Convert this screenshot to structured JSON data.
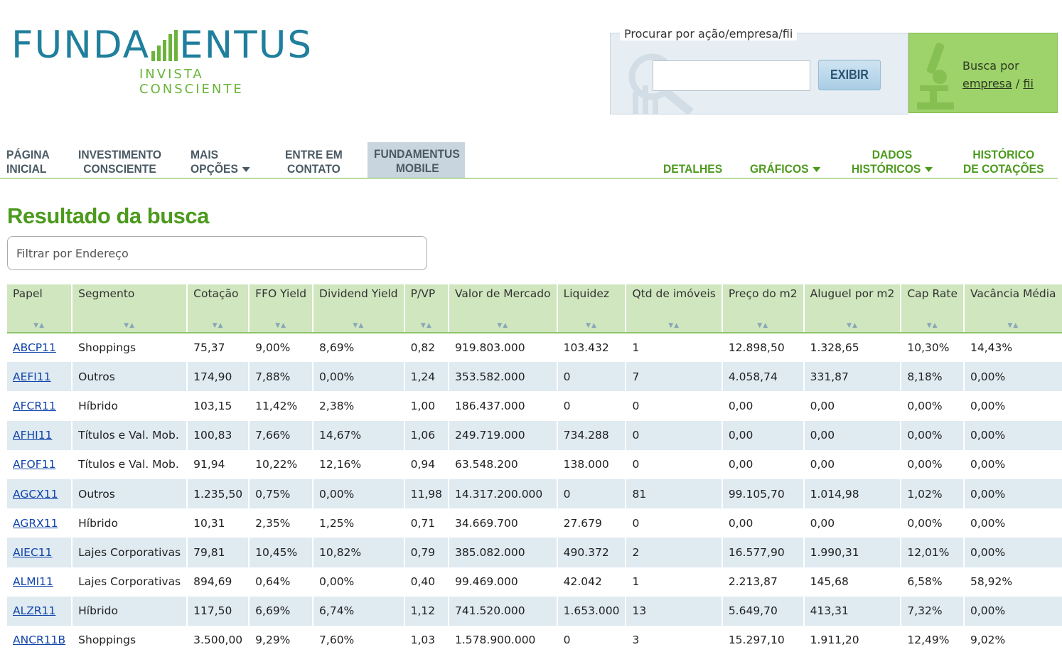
{
  "logo": {
    "main_left": "FUNDA",
    "main_right": "ENTUS",
    "tagline": "INVISTA CONSCIENTE"
  },
  "search": {
    "legend": "Procurar por ação/empresa/fii",
    "input_value": "",
    "button_label": "EXIBIR",
    "busca_prefix": "Busca por",
    "busca_link_empresa": "empresa",
    "busca_sep": " / ",
    "busca_link_fii": "fii"
  },
  "nav": {
    "pagina_inicial": [
      "PÁGINA",
      "INICIAL"
    ],
    "investimento": [
      "INVESTIMENTO",
      "CONSCIENTE"
    ],
    "mais_opcoes": [
      "MAIS",
      "OPÇÕES"
    ],
    "entre_em_contato": [
      "ENTRE EM",
      "CONTATO"
    ],
    "fundamentus_mobile": [
      "FUNDAMENTUS",
      "MOBILE"
    ],
    "detalhes": "DETALHES",
    "graficos": "GRÁFICOS",
    "dados_historicos": [
      "DADOS",
      "HISTÓRICOS"
    ],
    "historico_cotacoes": [
      "HISTÓRICO",
      "DE COTAÇÕES"
    ]
  },
  "page_title": "Resultado da busca",
  "filter_placeholder": "Filtrar por Endereço",
  "table": {
    "sort_glyph": "▼▲",
    "headers": [
      "Papel",
      "Segmento",
      "Cotação",
      "FFO Yield",
      "Dividend Yield",
      "P/VP",
      "Valor de Mercado",
      "Liquidez",
      "Qtd de imóveis",
      "Preço do m2",
      "Aluguel por m2",
      "Cap Rate",
      "Vacância Média"
    ],
    "rows": [
      [
        "ABCP11",
        "Shoppings",
        "75,37",
        "9,00%",
        "8,69%",
        "0,82",
        "919.803.000",
        "103.432",
        "1",
        "12.898,50",
        "1.328,65",
        "10,30%",
        "14,43%"
      ],
      [
        "AEFI11",
        "Outros",
        "174,90",
        "7,88%",
        "0,00%",
        "1,24",
        "353.582.000",
        "0",
        "7",
        "4.058,74",
        "331,87",
        "8,18%",
        "0,00%"
      ],
      [
        "AFCR11",
        "Híbrido",
        "103,15",
        "11,42%",
        "2,38%",
        "1,00",
        "186.437.000",
        "0",
        "0",
        "0,00",
        "0,00",
        "0,00%",
        "0,00%"
      ],
      [
        "AFHI11",
        "Títulos e Val. Mob.",
        "100,83",
        "7,66%",
        "14,67%",
        "1,06",
        "249.719.000",
        "734.288",
        "0",
        "0,00",
        "0,00",
        "0,00%",
        "0,00%"
      ],
      [
        "AFOF11",
        "Títulos e Val. Mob.",
        "91,94",
        "10,22%",
        "12,16%",
        "0,94",
        "63.548.200",
        "138.000",
        "0",
        "0,00",
        "0,00",
        "0,00%",
        "0,00%"
      ],
      [
        "AGCX11",
        "Outros",
        "1.235,50",
        "0,75%",
        "0,00%",
        "11,98",
        "14.317.200.000",
        "0",
        "81",
        "99.105,70",
        "1.014,98",
        "1,02%",
        "0,00%"
      ],
      [
        "AGRX11",
        "Híbrido",
        "10,31",
        "2,35%",
        "1,25%",
        "0,71",
        "34.669.700",
        "27.679",
        "0",
        "0,00",
        "0,00",
        "0,00%",
        "0,00%"
      ],
      [
        "AIEC11",
        "Lajes Corporativas",
        "79,81",
        "10,45%",
        "10,82%",
        "0,79",
        "385.082.000",
        "490.372",
        "2",
        "16.577,90",
        "1.990,31",
        "12,01%",
        "0,00%"
      ],
      [
        "ALMI11",
        "Lajes Corporativas",
        "894,69",
        "0,64%",
        "0,00%",
        "0,40",
        "99.469.000",
        "42.042",
        "1",
        "2.213,87",
        "145,68",
        "6,58%",
        "58,92%"
      ],
      [
        "ALZR11",
        "Híbrido",
        "117,50",
        "6,69%",
        "6,74%",
        "1,12",
        "741.520.000",
        "1.653.000",
        "13",
        "5.649,70",
        "413,31",
        "7,32%",
        "0,00%"
      ],
      [
        "ANCR11B",
        "Shoppings",
        "3.500,00",
        "9,29%",
        "7,60%",
        "1,03",
        "1.578.900.000",
        "0",
        "3",
        "15.297,10",
        "1.911,20",
        "12,49%",
        "9,02%"
      ]
    ]
  }
}
